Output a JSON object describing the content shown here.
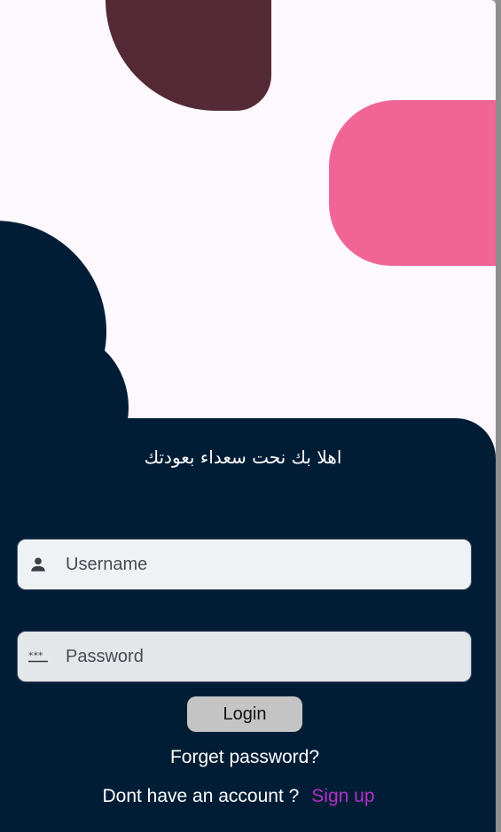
{
  "colors": {
    "background": "#fdf7fe",
    "panel": "#011d36",
    "maroon_shape": "#532a36",
    "pink_shape": "#f06594",
    "username_field_bg": "#eff2f5",
    "password_field_bg": "#e4e7ea",
    "login_button_bg": "#c4c4c4",
    "signup_link": "#b232c6"
  },
  "welcome_text": "اهلا بك نحت سعداء بعودتك",
  "username": {
    "icon": "person-icon",
    "placeholder": "Username",
    "value": ""
  },
  "password": {
    "icon": "password-icon",
    "placeholder": "Password",
    "value": ""
  },
  "login_label": "Login",
  "forget_password_label": "Forget password?",
  "signup": {
    "prompt": "Dont have an account ?",
    "link_label": "Sign up"
  }
}
